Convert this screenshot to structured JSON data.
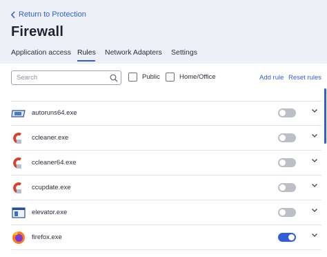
{
  "header": {
    "back_label": "Return to Protection",
    "title": "Firewall",
    "tabs": [
      {
        "label": "Application access"
      },
      {
        "label": "Rules"
      },
      {
        "label": "Network Adapters"
      },
      {
        "label": "Settings"
      }
    ],
    "active_tab": "Rules"
  },
  "toolbar": {
    "search_placeholder": "Search",
    "filters": [
      {
        "label": "Public",
        "checked": false
      },
      {
        "label": "Home/Office",
        "checked": false
      }
    ],
    "add_rule_label": "Add rule",
    "reset_rules_label": "Reset rules"
  },
  "rules": [
    {
      "name": "autoruns64.exe",
      "icon": "autoruns-icon",
      "enabled": false
    },
    {
      "name": "ccleaner.exe",
      "icon": "ccleaner-icon",
      "enabled": false
    },
    {
      "name": "ccleaner64.exe",
      "icon": "ccleaner-icon",
      "enabled": false
    },
    {
      "name": "ccupdate.exe",
      "icon": "ccleaner-icon",
      "enabled": false
    },
    {
      "name": "elevator.exe",
      "icon": "window-app-icon",
      "enabled": false
    },
    {
      "name": "firefox.exe",
      "icon": "firefox-icon",
      "enabled": true
    }
  ],
  "colors": {
    "accent": "#2f5fd6",
    "header_bg": "#eef0f7",
    "toggle_off": "#bcbfc7"
  }
}
